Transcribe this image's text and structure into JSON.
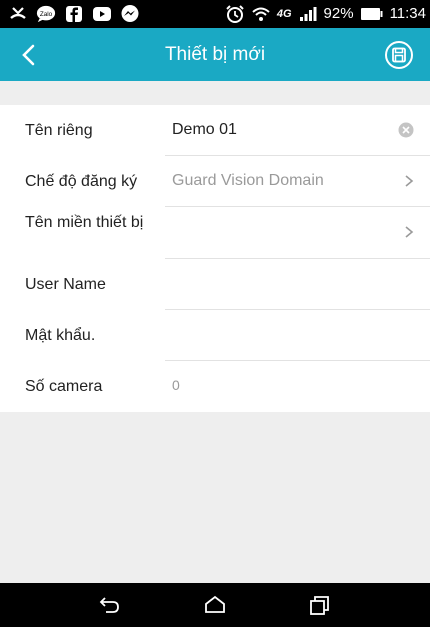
{
  "status_bar": {
    "left_icons": [
      "missed-call-icon",
      "zalo-icon",
      "facebook-icon",
      "youtube-icon",
      "messenger-icon"
    ],
    "zalo_text": "Zalo",
    "battery": "92%",
    "time": "11:34",
    "network": "4G"
  },
  "app_bar": {
    "title": "Thiết bị mới",
    "background": "#1aa9c4"
  },
  "form": {
    "fields": [
      {
        "label": "Tên riêng",
        "value": "Demo 01",
        "action": "clear"
      },
      {
        "label": "Chế độ đăng ký",
        "value": "Guard Vision Domain",
        "action": "chevron"
      },
      {
        "label": "Tên miền thiết bị",
        "value": "",
        "action": "chevron"
      },
      {
        "label": "User Name",
        "value": ""
      },
      {
        "label": "Mật khẩu.",
        "value": ""
      },
      {
        "label": "Số camera",
        "value": "0"
      }
    ]
  },
  "nav_bar": {
    "buttons": [
      "back-icon",
      "home-icon",
      "recents-icon"
    ]
  }
}
